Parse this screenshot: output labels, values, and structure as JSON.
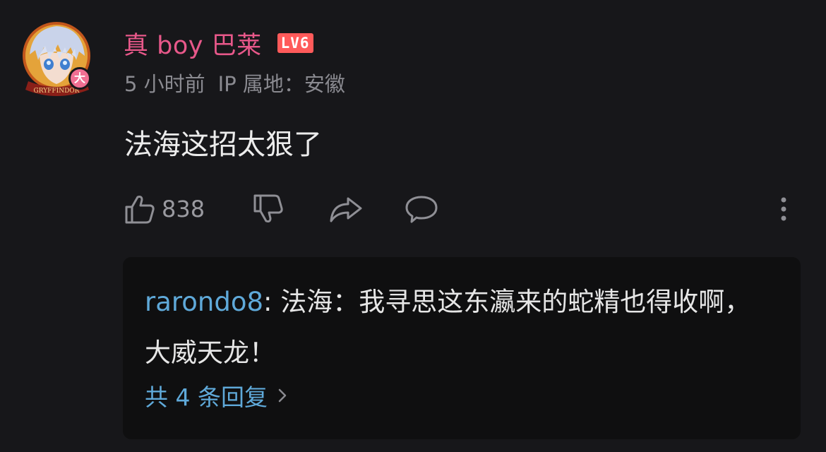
{
  "comment": {
    "avatar_badge": "大",
    "avatar_ring_text": "GRYFFINDOR",
    "username": "真 boy 巴莱",
    "level": "LV6",
    "time": "5 小时前",
    "ip_location": "IP 属地：安徽",
    "text": "法海这招太狠了",
    "like_count": "838"
  },
  "reply": {
    "author": "rarondo8",
    "separator": ": ",
    "text": "法海：我寻思这东瀛来的蛇精也得收啊，大威天龙！",
    "more_label": "共 4 条回复"
  },
  "colors": {
    "background": "#17171a",
    "username": "#e8588a",
    "level_badge": "#ff5a5a",
    "link": "#5fa9d9",
    "muted": "#8a8a90"
  },
  "icons": {
    "like": "thumbs-up-icon",
    "dislike": "thumbs-down-icon",
    "share": "share-arrow-icon",
    "reply": "chat-bubble-icon",
    "more": "more-vertical-icon",
    "chevron": "chevron-right-icon"
  }
}
